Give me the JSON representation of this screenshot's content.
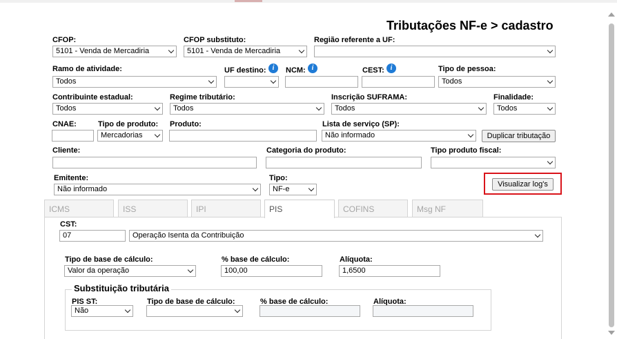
{
  "page": {
    "title": "Tributações NF-e > cadastro"
  },
  "row1": {
    "cfop": {
      "label": "CFOP:",
      "value": "5101 - Venda de Mercadiria"
    },
    "cfop_substituto": {
      "label": "CFOP substituto:",
      "value": "5101 - Venda de Mercadiria"
    },
    "regiao": {
      "label": "Região referente a UF:",
      "value": ""
    }
  },
  "row2": {
    "ramo": {
      "label": "Ramo de atividade:",
      "value": "Todos"
    },
    "uf_destino": {
      "label": "UF destino:",
      "value": ""
    },
    "ncm": {
      "label": "NCM:",
      "value": ""
    },
    "cest": {
      "label": "CEST:",
      "value": ""
    },
    "tipo_pessoa": {
      "label": "Tipo de pessoa:",
      "value": "Todos"
    }
  },
  "row3": {
    "contribuinte": {
      "label": "Contribuinte estadual:",
      "value": "Todos"
    },
    "regime": {
      "label": "Regime tributário:",
      "value": "Todos"
    },
    "suframa": {
      "label": "Inscrição SUFRAMA:",
      "value": "Todos"
    },
    "finalidade": {
      "label": "Finalidade:",
      "value": "Todos"
    }
  },
  "row4": {
    "cnae": {
      "label": "CNAE:",
      "value": ""
    },
    "tipo_produto": {
      "label": "Tipo de produto:",
      "value": "Mercadorias"
    },
    "produto": {
      "label": "Produto:",
      "value": ""
    },
    "lista_servico": {
      "label": "Lista de serviço (SP):",
      "value": "Não informado"
    },
    "duplicar_button": "Duplicar tributação"
  },
  "row5": {
    "cliente": {
      "label": "Cliente:",
      "value": ""
    },
    "categoria": {
      "label": "Categoria do produto:",
      "value": ""
    },
    "tipo_fiscal": {
      "label": "Tipo produto fiscal:",
      "value": ""
    }
  },
  "row6": {
    "emitente": {
      "label": "Emitente:",
      "value": "Não informado"
    },
    "tipo": {
      "label": "Tipo:",
      "value": "NF-e"
    },
    "log_button": "Visualizar log's"
  },
  "tabs": [
    {
      "label": "ICMS",
      "active": false
    },
    {
      "label": "ISS",
      "active": false
    },
    {
      "label": "IPI",
      "active": false
    },
    {
      "label": "PIS",
      "active": true
    },
    {
      "label": "COFINS",
      "active": false
    },
    {
      "label": "Msg NF",
      "active": false
    }
  ],
  "pis": {
    "cst": {
      "label": "CST:",
      "code": "07",
      "value": "Operação Isenta da Contribuição"
    },
    "tipo_base": {
      "label": "Tipo de base de cálculo:",
      "value": "Valor da operação"
    },
    "perc_base": {
      "label": "% base de cálculo:",
      "value": "100,00"
    },
    "aliquota": {
      "label": "Alíquota:",
      "value": "1,6500"
    },
    "st": {
      "legend": "Substituição tributária",
      "pis_st": {
        "label": "PIS ST:",
        "value": "Não"
      },
      "tipo_base": {
        "label": "Tipo de base de cálculo:",
        "value": ""
      },
      "perc_base": {
        "label": "% base de cálculo:",
        "value": ""
      },
      "aliquota": {
        "label": "Alíquota:",
        "value": ""
      }
    }
  },
  "colors": {
    "highlight_border": "#d9131a",
    "info_icon": "#1f7bd6"
  }
}
